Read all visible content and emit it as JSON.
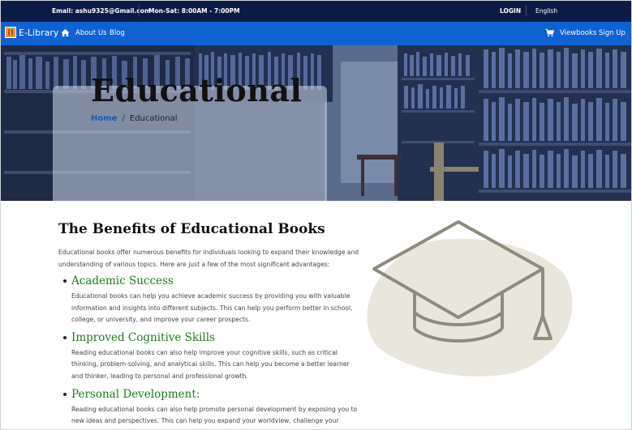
{
  "topbar": {
    "email": "Email: ashu9325@Gmail.com",
    "hours": "Mon-Sat: 8:00AM - 7:00PM",
    "login": "LOGIN",
    "language": "English"
  },
  "navbar": {
    "brand": "E-Library",
    "about": "About Us",
    "blog": "Blog",
    "viewbooks": "Viewbooks",
    "signup": "Sign Up"
  },
  "hero": {
    "title": "Educational",
    "breadcrumb": {
      "home": "Home",
      "separator": "/",
      "current": "Educational"
    }
  },
  "content": {
    "title": "The Benefits of Educational Books",
    "intro": "Educational books offer numerous benefits for individuals looking to expand their knowledge and understanding of various topics. Here are just a few of the most significant advantages:",
    "benefits": [
      {
        "title": "Academic Success",
        "desc": "Educational books can help you achieve academic success by providing you with valuable information and insights into different subjects. This can help you perform better in school, college, or university, and improve your career prospects."
      },
      {
        "title": "Improved Cognitive Skills",
        "desc": "Reading educational books can also help improve your cognitive skills, such as critical thinking, problem-solving, and analytical skills. This can help you become a better learner and thinker, leading to personal and professional growth."
      },
      {
        "title": "Personal Development:",
        "desc": "Reading educational books can also help promote personal development by exposing you to new ideas and perspectives. This can help you expand your worldview, challenge your assumptions, and develop a deeper understanding of the world around you."
      }
    ]
  },
  "icons": {
    "home": "home-icon",
    "cart": "cart-icon",
    "illustration": "graduation-cap-icon"
  },
  "colors": {
    "topbar_bg": "#0c1b46",
    "navbar_bg": "#1062d3",
    "breadcrumb_link": "#1558c0",
    "benefit_heading": "#1e7a1e",
    "illustration_blob": "#e9e6dc",
    "illustration_stroke": "#8f8c7c"
  }
}
